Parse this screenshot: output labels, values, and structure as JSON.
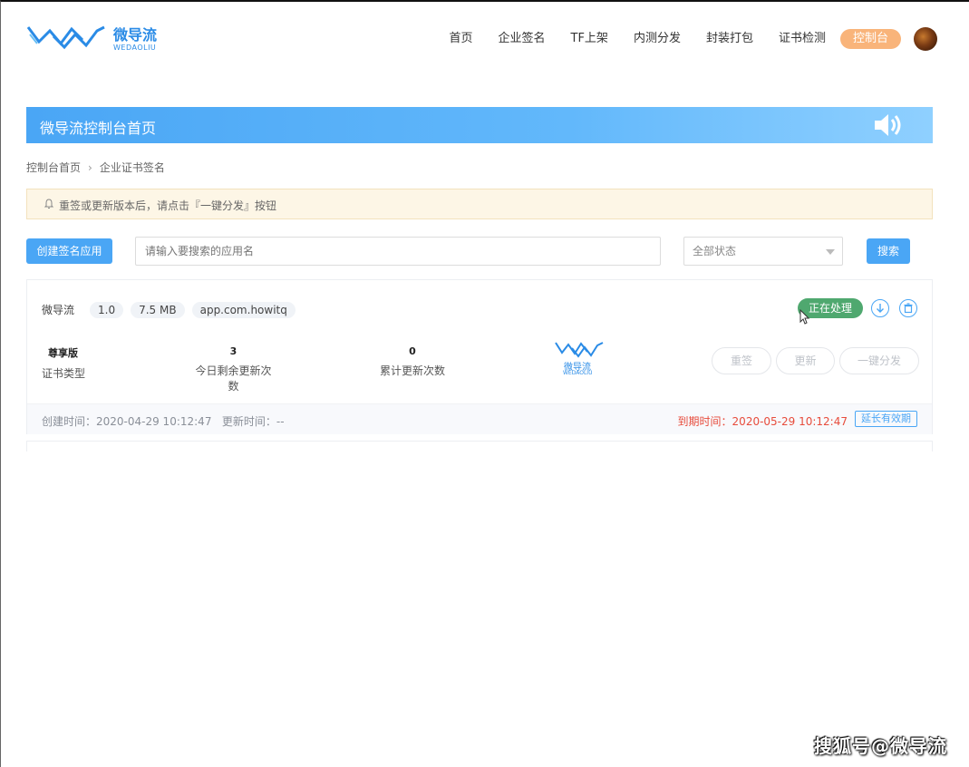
{
  "header": {
    "logo_cn": "微导流",
    "logo_en": "WEDAOLIU",
    "nav": [
      "首页",
      "企业签名",
      "TF上架",
      "内测分发",
      "封装打包",
      "证书检测"
    ],
    "console_label": "控制台"
  },
  "banner": {
    "title": "微导流控制台首页"
  },
  "breadcrumb": {
    "home": "控制台首页",
    "current": "企业证书签名"
  },
  "notice": {
    "text": "重签或更新版本后，请点击『一键分发』按钮"
  },
  "toolbar": {
    "create_label": "创建签名应用",
    "search_placeholder": "请输入要搜索的应用名",
    "status_value": "全部状态",
    "search_label": "搜索"
  },
  "app_card": {
    "name": "微导流",
    "version": "1.0",
    "size": "7.5 MB",
    "bundle_id": "app.com.howitq",
    "status": "正在处理",
    "cert_type_value": "尊享版",
    "cert_type_label": "证书类型",
    "remaining_value": "3",
    "remaining_label": "今日剩余更新次数",
    "total_value": "0",
    "total_label": "累计更新次数",
    "app_logo_cn": "微导流",
    "app_logo_en": "WEDAOLIU",
    "btn_resign": "重签",
    "btn_update": "更新",
    "btn_distribute": "一键分发",
    "created": "创建时间：2020-04-29 10:12:47",
    "updated": "更新时间：--",
    "expire": "到期时间：2020-05-29 10:12:47",
    "extend_label": "延长有效期"
  },
  "watermark": "搜狐号@微导流",
  "colors": {
    "accent": "#4aa6f5",
    "status_green": "#4fa86f",
    "console_orange": "#f9b47a",
    "expire_red": "#e74c3c"
  }
}
